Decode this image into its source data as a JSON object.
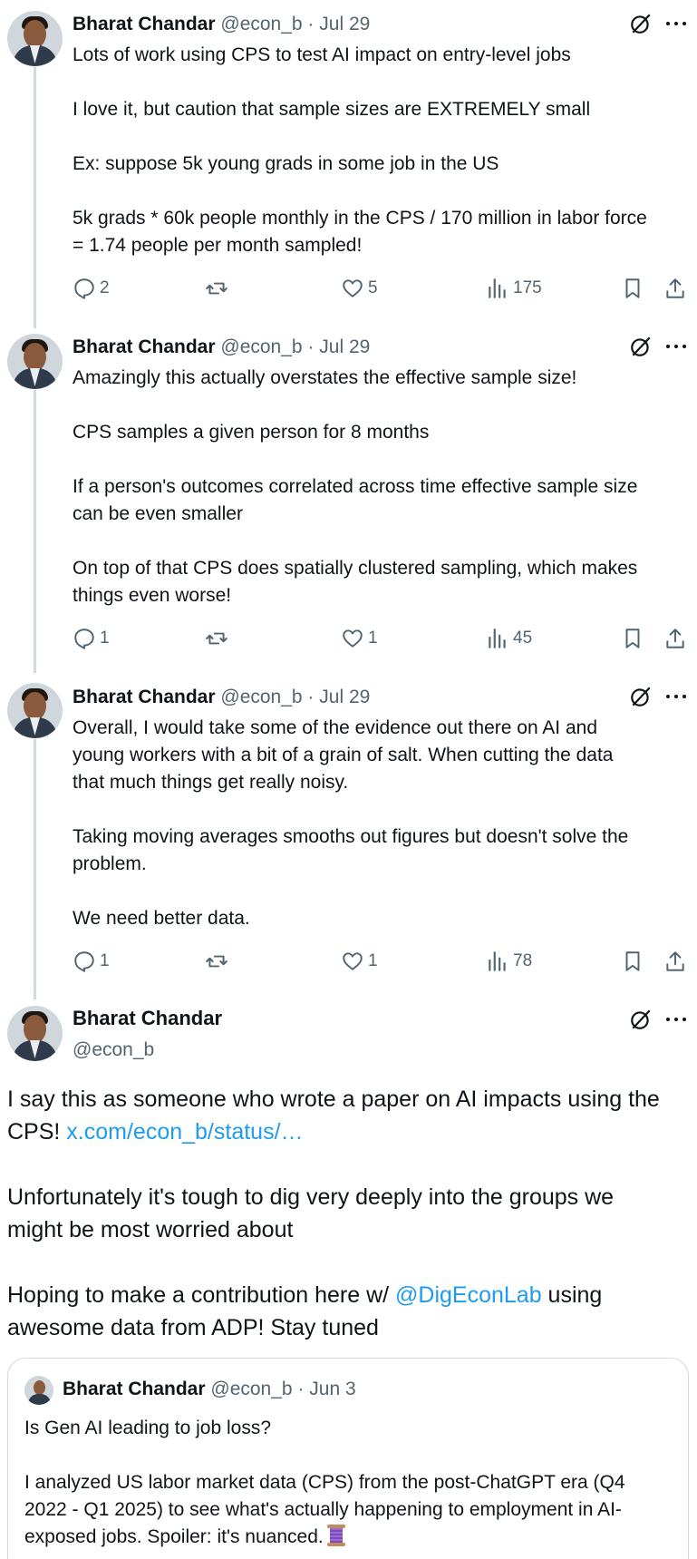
{
  "thread": [
    {
      "name": "Bharat Chandar",
      "handle": "@econ_b",
      "date": "Jul 29",
      "lines": [
        "Lots of work using CPS to test AI impact on entry-level jobs",
        "",
        "I love it, but caution that sample sizes are EXTREMELY small",
        "",
        "Ex: suppose 5k young grads in some job in the US",
        "",
        "5k grads * 60k people monthly in the CPS / 170 million in labor force",
        "= 1.74 people per month sampled!"
      ],
      "replies": "2",
      "reposts": "",
      "likes": "5",
      "views": "175"
    },
    {
      "name": "Bharat Chandar",
      "handle": "@econ_b",
      "date": "Jul 29",
      "lines": [
        "Amazingly this actually overstates the effective sample size!",
        "",
        "CPS samples a given person for 8 months",
        "",
        "If a person's outcomes correlated across time effective sample size",
        "can be even smaller",
        "",
        "On top of that CPS does spatially clustered sampling, which makes",
        "things even worse!"
      ],
      "replies": "1",
      "reposts": "",
      "likes": "1",
      "views": "45"
    },
    {
      "name": "Bharat Chandar",
      "handle": "@econ_b",
      "date": "Jul 29",
      "lines": [
        "Overall, I would take some of the evidence out there on AI and",
        "young workers with a bit of a grain of salt. When cutting the data",
        "that much things get really noisy.",
        "",
        "Taking moving averages smooths out figures but doesn't  solve the",
        "problem.",
        "",
        "We need better data."
      ],
      "replies": "1",
      "reposts": "",
      "likes": "1",
      "views": "78"
    }
  ],
  "main": {
    "name": "Bharat Chandar",
    "handle": "@econ_b",
    "p1_line1": "I say this as someone who wrote a paper on AI impacts using the",
    "p1_line2_prefix": "CPS! ",
    "p1_link": "x.com/econ_b/status/…",
    "p2_line1": "Unfortunately it's tough to dig very deeply into the groups we",
    "p2_line2": "might be most worried about",
    "p3_line1_prefix": "Hoping to make a contribution here w/ ",
    "p3_mention": "@DigEconLab",
    "p3_line1_suffix": " using",
    "p3_line2": "awesome data from ADP! Stay tuned"
  },
  "quote": {
    "name": "Bharat Chandar",
    "handle": "@econ_b",
    "date": "Jun 3",
    "line1": "Is Gen AI leading to job loss?",
    "line2": "I analyzed US labor market data (CPS) from the post-ChatGPT era (Q4",
    "line3": "2022 - Q1 2025) to see what's actually happening to employment in AI-",
    "line4": "exposed jobs. Spoiler: it's nuanced."
  },
  "separator": " · "
}
